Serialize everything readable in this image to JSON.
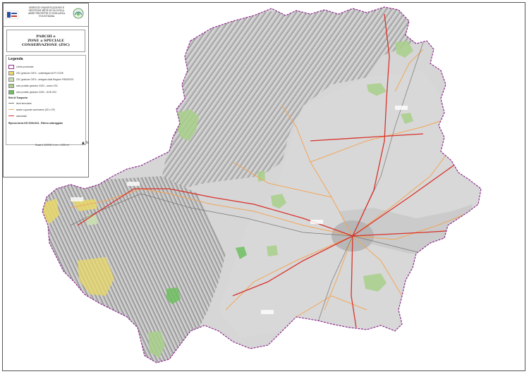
{
  "header": {
    "org_lines": [
      "SERVIZIO PIANIFICAZIONE E",
      "GESTIONE RETE ECOLOGICA,",
      "AREE PROTETTE E VIGILANZA",
      "VOLONTARIA"
    ],
    "logo_left_icon": "provincia-torino-logo-icon",
    "logo_right_icon": "rete-ecologica-logo-icon"
  },
  "title": {
    "lines": [
      "PARCHI e",
      "ZONE a SPECIALE",
      "CONSERVAZIONE (ZSC)"
    ]
  },
  "legend": {
    "heading": "Legenda",
    "items": [
      {
        "label": "Limite provinciale",
        "color": "#8e2c8e",
        "kind": "outline"
      },
      {
        "label": "ZSC gestione CMTo - subdelegato ALPI COZIE",
        "color": "#e8d86a",
        "kind": "fill"
      },
      {
        "label": "ZSC gestione CMTo - delegato dalla Regione PIEMONTE",
        "color": "#c9e0b0",
        "kind": "fill"
      },
      {
        "label": "aree protette gestione CMTo - anche ZSC",
        "color": "#a8d08a",
        "kind": "fill"
      },
      {
        "label": "aree protette gestione CMTo - NON ZSC",
        "color": "#6fbf5f",
        "kind": "fill"
      }
    ],
    "transport_heading": "Reti di Trasporto",
    "transport": [
      {
        "label": "linee ferroviarie",
        "color": "#777777"
      },
      {
        "label": "strade a grande scorrimento (SS e SP)",
        "color": "#f2a65a"
      },
      {
        "label": "autostrade",
        "color": "#d9322b"
      }
    ],
    "note": "Ripresa Aerea ICE 2009-2011 - Rilievo ombreggiato"
  },
  "scale": {
    "text": "Scala 1:120000   1 cm = 1200 ml"
  },
  "north_arrow": {
    "label": "N"
  },
  "colors": {
    "relief_light": "#d9d9d9",
    "relief_mid": "#b8b8b8",
    "relief_dark": "#7a7a7a",
    "boundary": "#8e2c8e",
    "city": "#b0b0b0",
    "motorway": "#d9322b",
    "main_road": "#f2a65a"
  }
}
